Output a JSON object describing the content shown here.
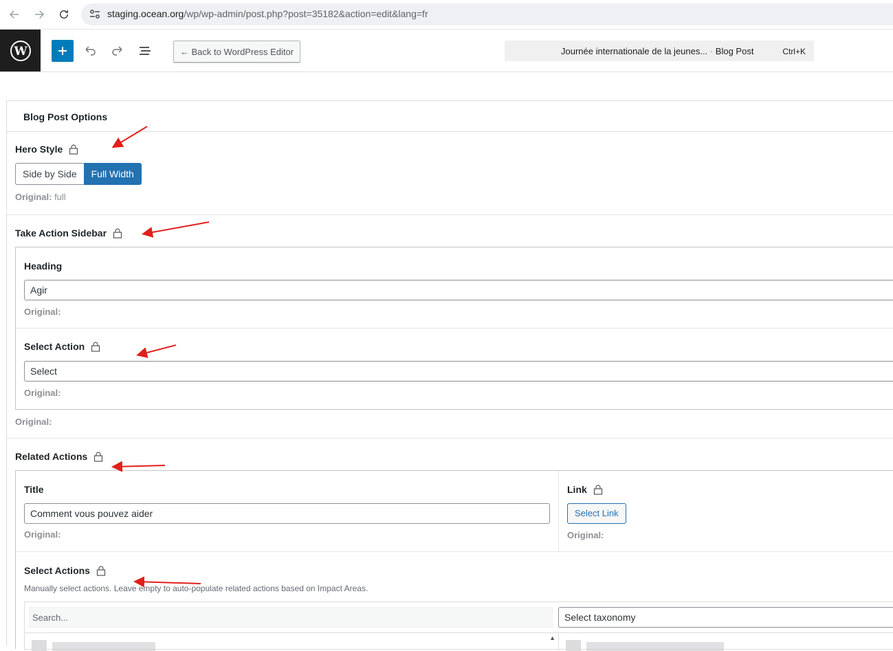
{
  "browser": {
    "url_domain": "staging.ocean.org",
    "url_path": "/wp/wp-admin/post.php?post=35182&action=edit&lang=fr"
  },
  "toolbar": {
    "back_label": "← Back to WordPress Editor",
    "doc_title": "Journée internationale de la jeunes...",
    "doc_sep": " · ",
    "doc_type": "Blog Post",
    "shortcut": "Ctrl+K"
  },
  "panel": {
    "title": "Blog Post Options",
    "hero_style": {
      "label": "Hero Style",
      "options": [
        "Side by Side",
        "Full Width"
      ],
      "selected": "Full Width",
      "original_label": "Original:",
      "original_value": " full"
    },
    "take_action": {
      "label": "Take Action Sidebar",
      "heading_label": "Heading",
      "heading_value": "Agir",
      "heading_original": "Original:",
      "select_action_label": "Select Action",
      "select_action_value": "Select",
      "select_action_original": "Original:",
      "group_original": "Original:"
    },
    "related_actions": {
      "label": "Related Actions",
      "title_label": "Title",
      "title_value": "Comment vous pouvez aider",
      "title_original": "Original:",
      "link_label": "Link",
      "link_button": "Select Link",
      "link_original": "Original:",
      "select_actions_label": "Select Actions",
      "select_actions_desc": "Manually select actions. Leave empty to auto-populate related actions based on Impact Areas.",
      "search_placeholder": "Search...",
      "taxonomy_placeholder": "Select taxonomy"
    }
  },
  "colors": {
    "accent": "#2271b1",
    "wp_blue": "#007cba",
    "annotation_arrow": "#e0201b"
  }
}
